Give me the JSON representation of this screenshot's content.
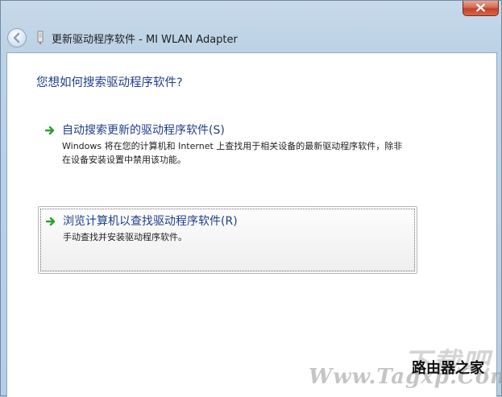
{
  "window": {
    "title": "更新驱动程序软件 - MI WLAN Adapter"
  },
  "content": {
    "question": "您想如何搜索驱动程序软件?",
    "options": [
      {
        "title": "自动搜索更新的驱动程序软件(S)",
        "description": "Windows 将在您的计算机和 Internet 上查找用于相关设备的最新驱动程序软件，除非在设备安装设置中禁用该功能。"
      },
      {
        "title": "浏览计算机以查找驱动程序软件(R)",
        "description": "手动查找并安装驱动程序软件。"
      }
    ]
  },
  "watermark": {
    "logo": "下载吧",
    "url": "Www.Tagxp.Com",
    "tag": "路由器之家"
  },
  "colors": {
    "link_blue": "#1f3f8c",
    "arrow_green": "#2aa12a",
    "close_red": "#c2412a"
  },
  "icons": {
    "close": "close-icon",
    "back": "back-arrow-icon",
    "device": "device-icon",
    "option_arrow": "green-arrow-icon"
  }
}
